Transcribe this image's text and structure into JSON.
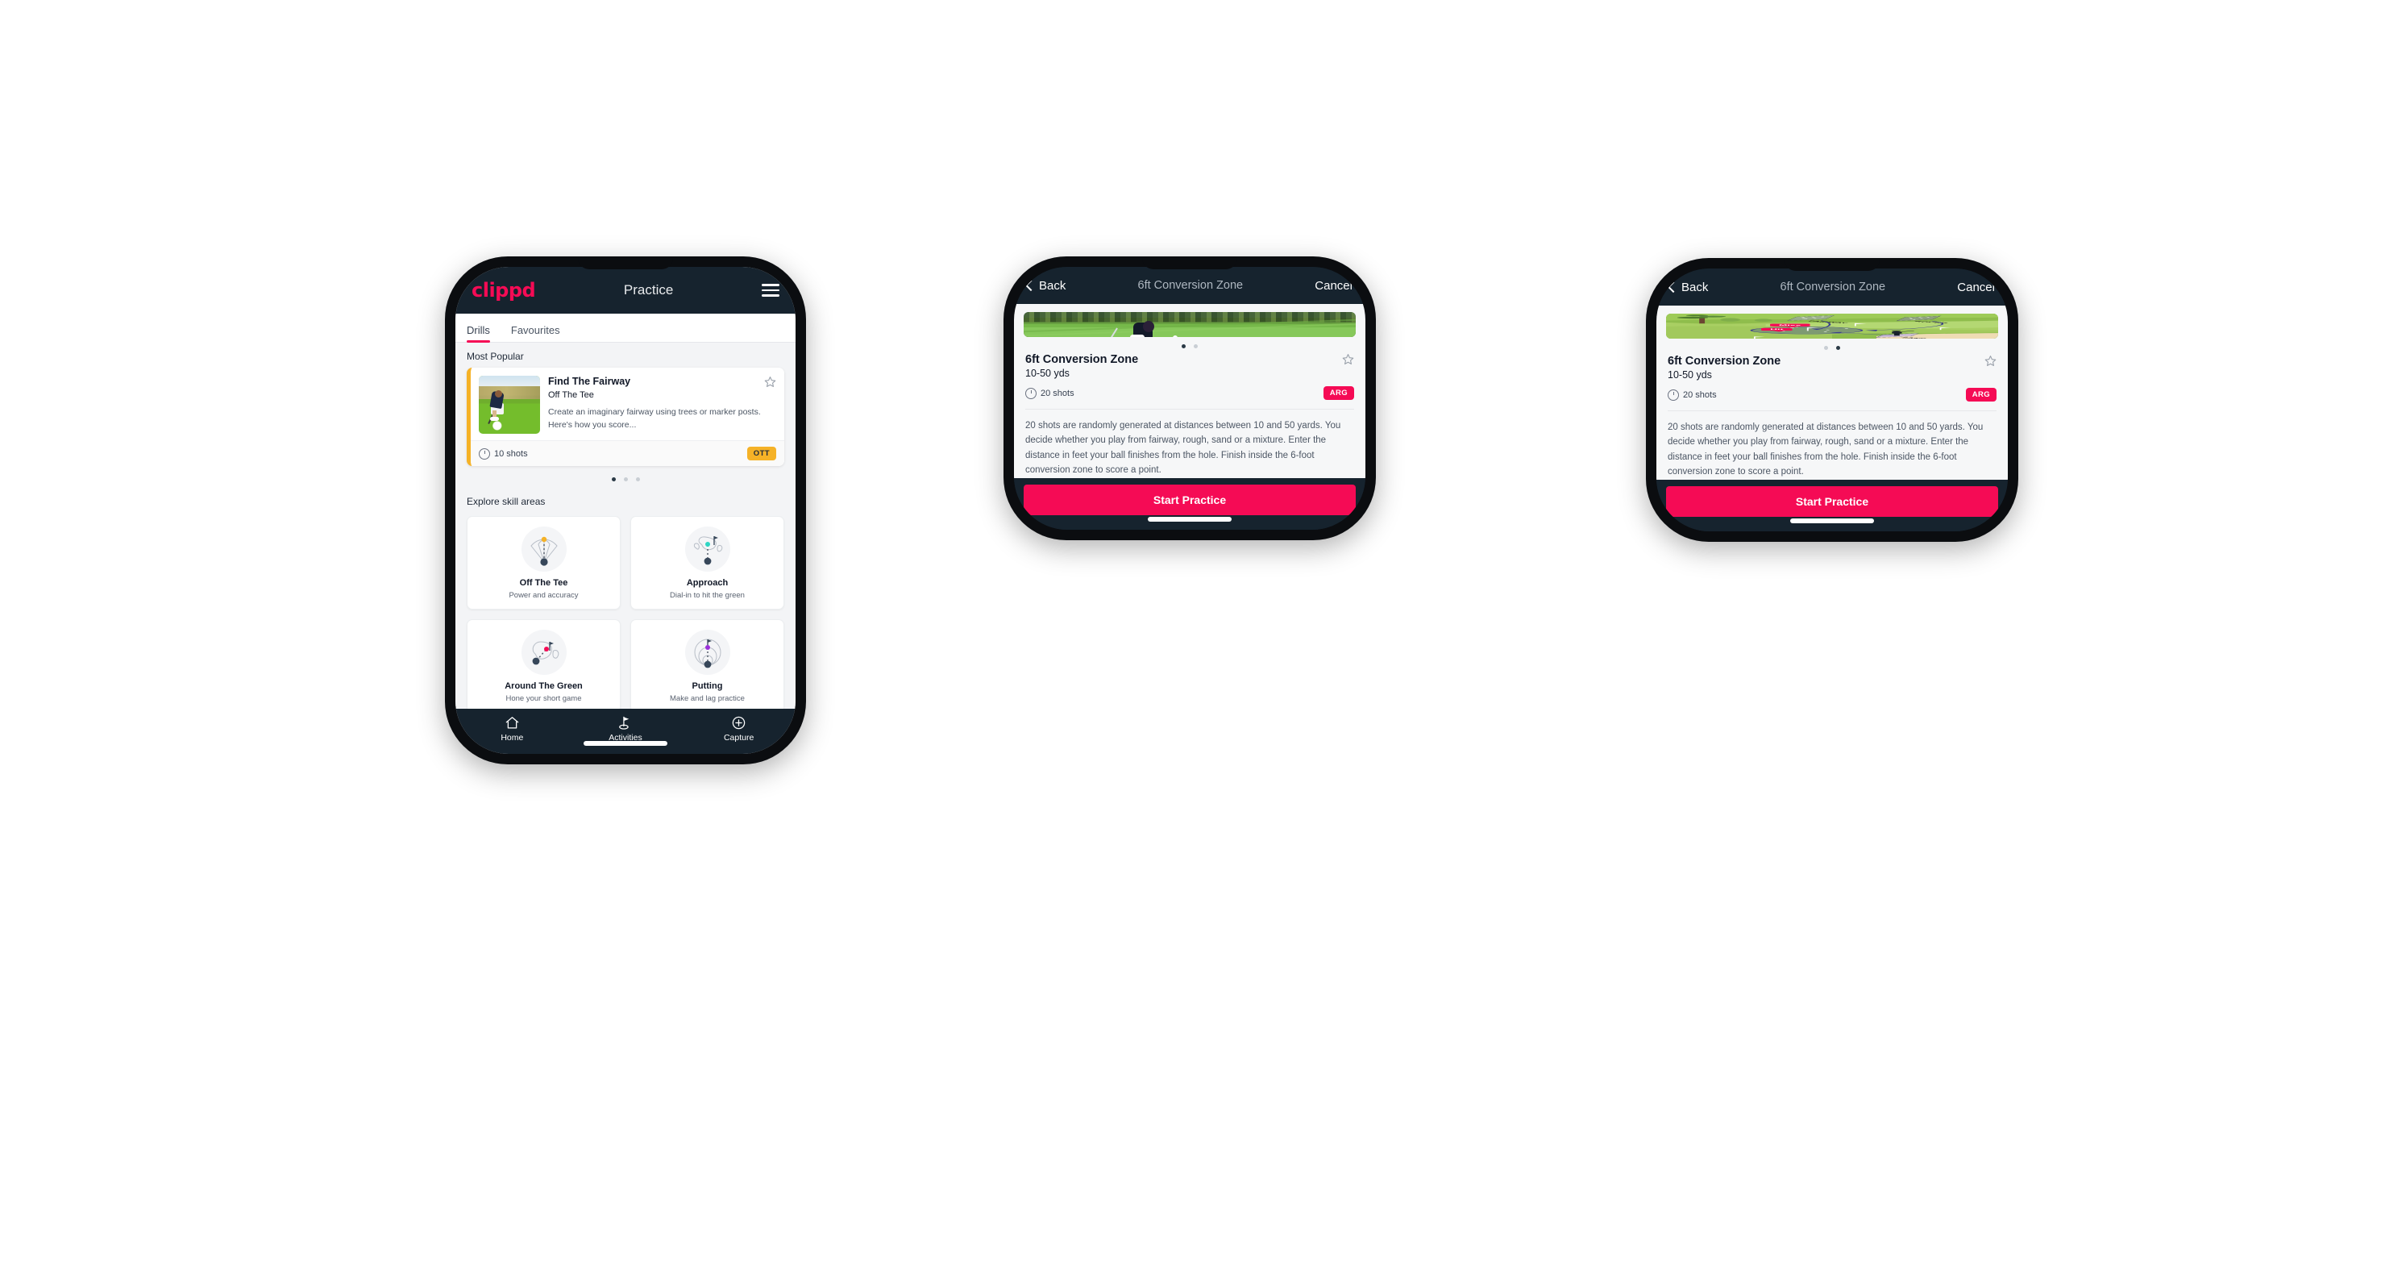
{
  "phone1": {
    "topbar": {
      "brand": "clippd",
      "title": "Practice",
      "menu_icon": "hamburger-icon"
    },
    "tabs": [
      {
        "label": "Drills",
        "active": true
      },
      {
        "label": "Favourites",
        "active": false
      }
    ],
    "most_popular": {
      "section_title": "Most Popular",
      "card": {
        "title": "Find The Fairway",
        "subtitle": "Off The Tee",
        "description": "Create an imaginary fairway using trees or marker posts. Here's how you score...",
        "shots": "10 shots",
        "tag": "OTT",
        "tag_color": "#f5b227",
        "favourite_icon": "star-outline-icon",
        "accent_color": "#f5b227",
        "next_card_accent": "#2fd6c4"
      },
      "carousel_dots": 3,
      "carousel_active": 0
    },
    "skills": {
      "section_title": "Explore skill areas",
      "items": [
        {
          "name": "Off The Tee",
          "desc": "Power and accuracy",
          "icon": "tee-fan-icon",
          "accent": "#f5b227"
        },
        {
          "name": "Approach",
          "desc": "Dial-in to hit the green",
          "icon": "green-approach-icon",
          "accent": "#2fd6c4"
        },
        {
          "name": "Around The Green",
          "desc": "Hone your short game",
          "icon": "chip-green-icon",
          "accent": "#f50b55"
        },
        {
          "name": "Putting",
          "desc": "Make and lag practice",
          "icon": "putting-rings-icon",
          "accent": "#9b30d9"
        }
      ]
    },
    "bottom_nav": [
      {
        "label": "Home",
        "icon": "home-icon",
        "active": false
      },
      {
        "label": "Activities",
        "icon": "golf-flag-icon",
        "active": true
      },
      {
        "label": "Capture",
        "icon": "plus-circle-icon",
        "active": false
      }
    ]
  },
  "phone2": {
    "topbar": {
      "back": "Back",
      "title": "6ft Conversion Zone",
      "cancel": "Cancel",
      "back_icon": "chevron-left-icon"
    },
    "media": {
      "type": "photo",
      "alt": "golfer-chipping-photo"
    },
    "carousel_dots": 2,
    "carousel_active": 0,
    "detail": {
      "name": "6ft Conversion Zone",
      "yards": "10-50 yds",
      "shots": "20 shots",
      "tag": "ARG",
      "tag_color": "#f50b55",
      "favourite_icon": "star-outline-icon",
      "description": "20 shots are randomly generated at distances between 10 and 50 yards. You decide whether you play from fairway, rough, sand or a mixture. Enter the distance in feet your ball finishes from the hole. Finish inside the 6-foot conversion zone to score a point."
    },
    "cta": "Start Practice"
  },
  "phone3": {
    "topbar": {
      "back": "Back",
      "title": "6ft Conversion Zone",
      "cancel": "Cancel",
      "back_icon": "chevron-left-icon"
    },
    "media": {
      "type": "diagram",
      "alt": "golf-course-lie-diagram",
      "labels": [
        "FAIRWAY",
        "ROUGH",
        "SAND"
      ],
      "markers": [
        {
          "label": "Miss",
          "color": "#f50b55"
        },
        {
          "label": "Hit",
          "color": "#f50b55"
        }
      ]
    },
    "carousel_dots": 2,
    "carousel_active": 1,
    "detail": {
      "name": "6ft Conversion Zone",
      "yards": "10-50 yds",
      "shots": "20 shots",
      "tag": "ARG",
      "tag_color": "#f50b55",
      "favourite_icon": "star-outline-icon",
      "description": "20 shots are randomly generated at distances between 10 and 50 yards. You decide whether you play from fairway, rough, sand or a mixture. Enter the distance in feet your ball finishes from the hole. Finish inside the 6-foot conversion zone to score a point."
    },
    "cta": "Start Practice"
  },
  "theme": {
    "brand_pink": "#f50b55",
    "dark_navy": "#16232e",
    "page_bg": "#f3f4f6",
    "white": "#ffffff"
  }
}
